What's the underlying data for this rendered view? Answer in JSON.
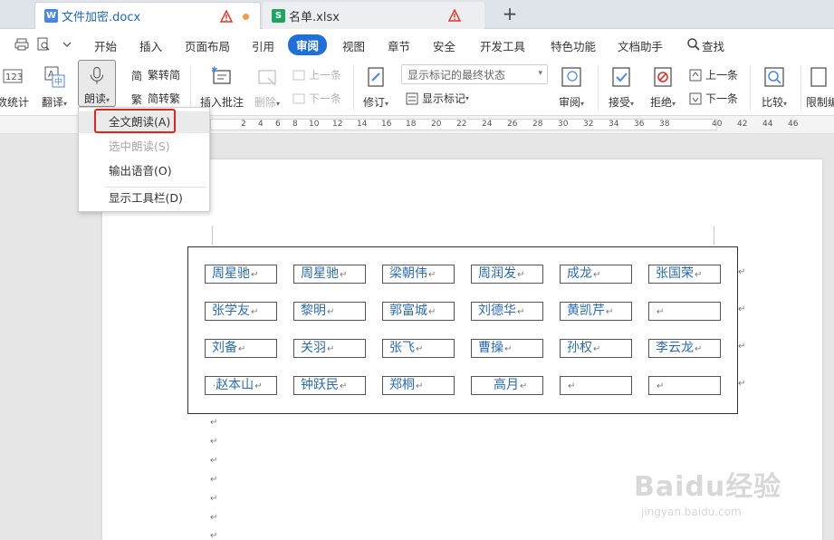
{
  "tabs": [
    {
      "name": "文件加密.docx",
      "icon": "W",
      "active": true
    },
    {
      "name": "名单.xlsx",
      "icon": "S",
      "active": false
    }
  ],
  "menu": [
    "开始",
    "插入",
    "页面布局",
    "引用",
    "审阅",
    "视图",
    "章节",
    "安全",
    "开发工具",
    "特色功能",
    "文档助手"
  ],
  "search_label": "查找",
  "ribbon": {
    "word_count": "数统计",
    "translate": "翻译",
    "read_aloud": "朗读",
    "trad_simp": "繁转简",
    "simp_trad": "简转繁",
    "insert_comment": "插入批注",
    "delete": "删除",
    "prev": "上一条",
    "next": "下一条",
    "track": "修订",
    "markup_select": "显示标记的最终状态",
    "show_markup": "显示标记",
    "review": "审阅",
    "accept": "接受",
    "reject": "拒绝",
    "prev2": "上一条",
    "next2": "下一条",
    "compare": "比较",
    "restrict": "限制编"
  },
  "ruler_ticks": [
    "2",
    "4",
    "6",
    "8",
    "10",
    "12",
    "14",
    "16",
    "18",
    "20",
    "22",
    "24",
    "26",
    "28",
    "30",
    "32",
    "34",
    "36",
    "38",
    "40",
    "42",
    "44",
    "46"
  ],
  "dropdown": {
    "full_read": "全文朗读(A)",
    "selected_read": "选中朗读(S)",
    "export_voice": "输出语音(O)",
    "show_toolbar": "显示工具栏(D)"
  },
  "table_rows": [
    [
      "周星驰",
      "周星驰",
      "梁朝伟",
      "周润发",
      "成龙",
      "张国荣"
    ],
    [
      "张学友",
      "黎明",
      "郭富城",
      "刘德华",
      "黄凯芹",
      ""
    ],
    [
      "刘备",
      "关羽",
      "张飞",
      "曹操",
      "孙权",
      "李云龙"
    ],
    [
      "赵本山",
      "钟跃民",
      "郑桐",
      "高月",
      "",
      ""
    ]
  ],
  "watermark": {
    "brand": "Baidu经验",
    "url": "jingyan.baidu.com"
  },
  "colors": {
    "accent": "#1e6fd9",
    "highlight_box": "#e0231c"
  }
}
